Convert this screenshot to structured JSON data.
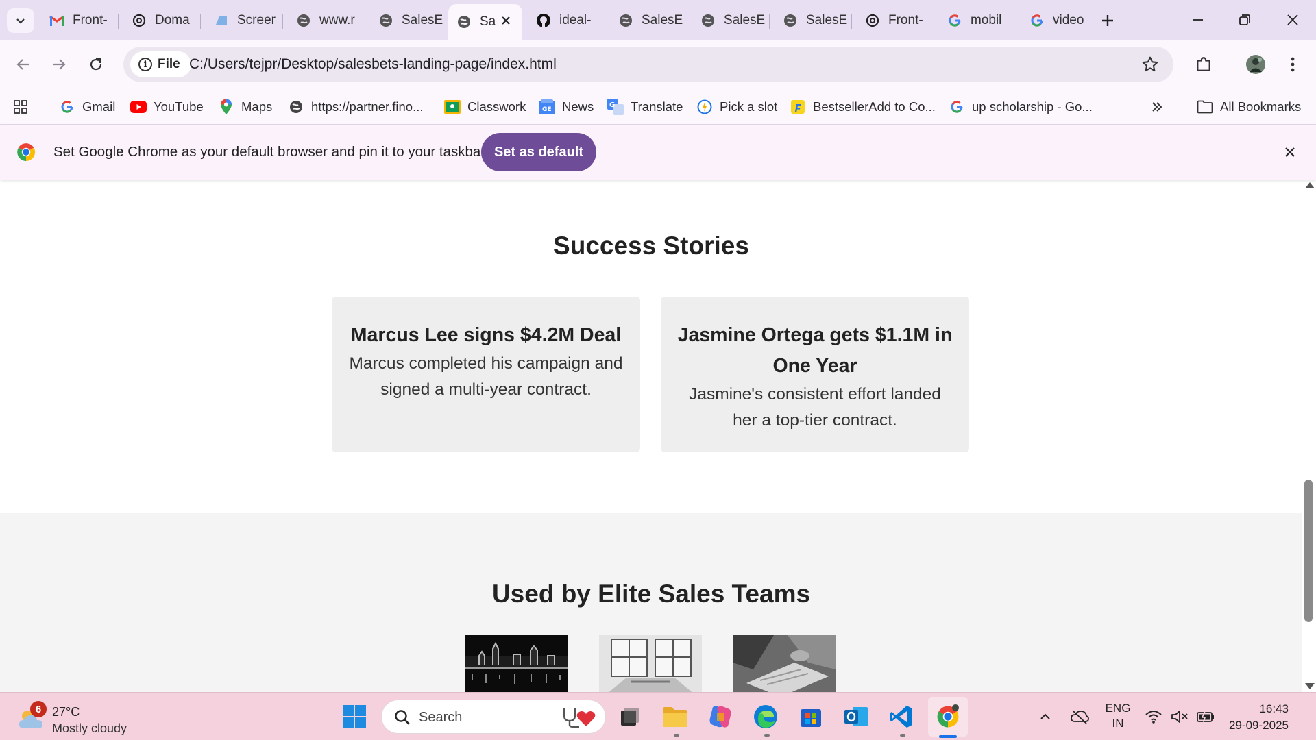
{
  "browser": {
    "tabs": [
      {
        "title": "Front-",
        "icon": "gmail-icon"
      },
      {
        "title": "Doma",
        "icon": "openai-icon"
      },
      {
        "title": "Screer",
        "icon": "cloud-icon"
      },
      {
        "title": "www.r",
        "icon": "globe-icon"
      },
      {
        "title": "SalesE",
        "icon": "globe-icon"
      },
      {
        "title": "Sa",
        "icon": "globe-icon",
        "active": true
      },
      {
        "title": "ideal-",
        "icon": "github-icon"
      },
      {
        "title": "SalesE",
        "icon": "globe-icon"
      },
      {
        "title": "SalesE",
        "icon": "globe-icon"
      },
      {
        "title": "SalesE",
        "icon": "globe-icon"
      },
      {
        "title": "Front-",
        "icon": "openai-icon"
      },
      {
        "title": "mobil",
        "icon": "google-icon"
      },
      {
        "title": "video",
        "icon": "google-icon"
      }
    ],
    "address": {
      "chip_label": "File",
      "url": "C:/Users/tejpr/Desktop/salesbets-landing-page/index.html"
    },
    "bookmarks": [
      {
        "label": "Gmail",
        "icon": "google-icon"
      },
      {
        "label": "YouTube",
        "icon": "youtube-icon"
      },
      {
        "label": "Maps",
        "icon": "maps-pin-icon"
      },
      {
        "label": "https://partner.fino...",
        "icon": "globe-icon"
      },
      {
        "label": "Classwork",
        "icon": "classroom-icon"
      },
      {
        "label": "News",
        "icon": "news-icon"
      },
      {
        "label": "Translate",
        "icon": "translate-icon"
      },
      {
        "label": "Pick a slot",
        "icon": "slot-icon"
      },
      {
        "label": "BestsellerAdd to Co...",
        "icon": "flipkart-icon"
      },
      {
        "label": "up scholarship - Go...",
        "icon": "google-icon"
      }
    ],
    "all_bookmarks_label": "All Bookmarks",
    "infobar": {
      "message": "Set Google Chrome as your default browser and pin it to your taskbar",
      "button_label": "Set as default"
    }
  },
  "page": {
    "success_heading": "Success Stories",
    "stories": [
      {
        "title": "Marcus Lee signs $4.2M Deal",
        "body": "Marcus completed his campaign and signed a multi-year contract."
      },
      {
        "title": "Jasmine Ortega gets $1.1M in One Year",
        "body": "Jasmine's consistent effort landed her a top-tier contract."
      }
    ],
    "teams_heading": "Used by Elite Sales Teams"
  },
  "taskbar": {
    "weather": {
      "temp": "27°C",
      "condition": "Mostly cloudy",
      "badge": "6"
    },
    "search_label": "Search",
    "language": {
      "line1": "ENG",
      "line2": "IN"
    },
    "clock": {
      "time": "16:43",
      "date": "29-09-2025"
    }
  },
  "colors": {
    "tabstrip_bg": "#e8dff2",
    "set_default_button": "#6f4c98",
    "taskbar_bg": "#f4d1dc",
    "card_bg": "#eeeeee"
  }
}
